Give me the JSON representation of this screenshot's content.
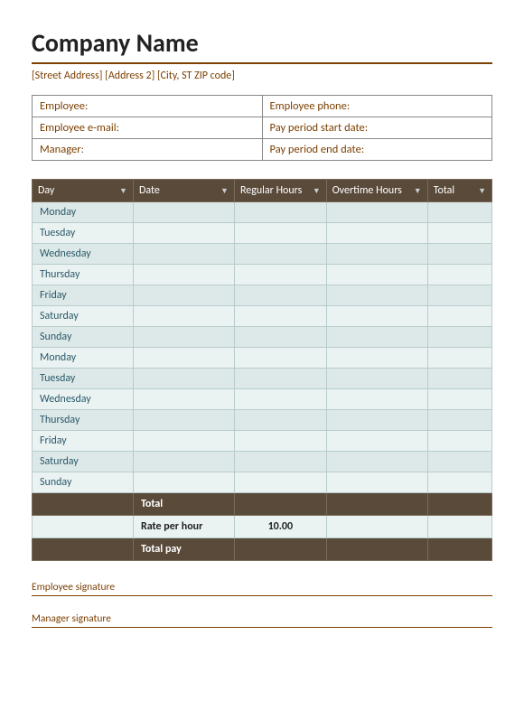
{
  "company": {
    "name": "Company Name",
    "address": "[Street Address] [Address 2] [City, ST ZIP code]"
  },
  "info_fields": [
    {
      "left_label": "Employee:",
      "right_label": "Employee phone:"
    },
    {
      "left_label": "Employee e-mail:",
      "right_label": "Pay period start date:"
    },
    {
      "left_label": "Manager:",
      "right_label": "Pay period end date:"
    }
  ],
  "table": {
    "headers": [
      {
        "label": "Day",
        "key": "day"
      },
      {
        "label": "Date",
        "key": "date"
      },
      {
        "label": "Regular Hours",
        "key": "regular"
      },
      {
        "label": "Overtime Hours",
        "key": "overtime"
      },
      {
        "label": "Total",
        "key": "total"
      }
    ],
    "rows": [
      {
        "day": "Monday"
      },
      {
        "day": "Tuesday"
      },
      {
        "day": "Wednesday"
      },
      {
        "day": "Thursday"
      },
      {
        "day": "Friday"
      },
      {
        "day": "Saturday"
      },
      {
        "day": "Sunday"
      },
      {
        "day": "Monday"
      },
      {
        "day": "Tuesday"
      },
      {
        "day": "Wednesday"
      },
      {
        "day": "Thursday"
      },
      {
        "day": "Friday"
      },
      {
        "day": "Saturday"
      },
      {
        "day": "Sunday"
      }
    ],
    "total_row_label": "Total",
    "rate_label": "Rate per hour",
    "rate_value": "10.00",
    "total_pay_label": "Total pay"
  },
  "signatures": [
    {
      "label": "Employee signature"
    },
    {
      "label": "Manager signature"
    }
  ]
}
